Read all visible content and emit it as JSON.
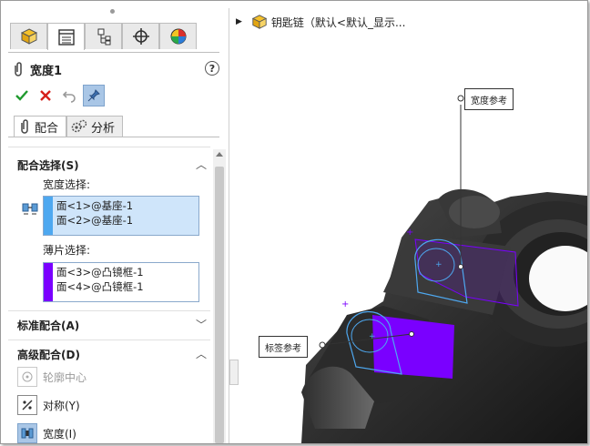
{
  "tree": {
    "document": "钥匙链（默认<默认_显示..."
  },
  "panel": {
    "tab_icons": [
      "part-icon",
      "property-manager-icon",
      "configuration-icon",
      "origin-target-icon",
      "appearance-icon"
    ],
    "title": "宽度1",
    "help": "?",
    "subtabs": [
      "配合",
      "分析"
    ],
    "mate_selections": {
      "heading": "配合选择(S)",
      "width_label": "宽度选择:",
      "width_items": [
        "面<1>@基座-1",
        "面<2>@基座-1"
      ],
      "tab_label": "薄片选择:",
      "tab_items": [
        "面<3>@凸镜框-1",
        "面<4>@凸镜框-1"
      ]
    },
    "standard_mates": {
      "heading": "标准配合(A)"
    },
    "advanced_mates": {
      "heading": "高级配合(D)",
      "items": [
        "轮廓中心",
        "对称(Y)",
        "宽度(I)"
      ]
    }
  },
  "callouts": {
    "width_ref": "宽度参考",
    "tab_ref": "标签参考"
  },
  "colors": {
    "selection_blue": "#4ea8f0",
    "tab_purple": "#7a00ff",
    "selected_bg": "#cfe5fa"
  }
}
